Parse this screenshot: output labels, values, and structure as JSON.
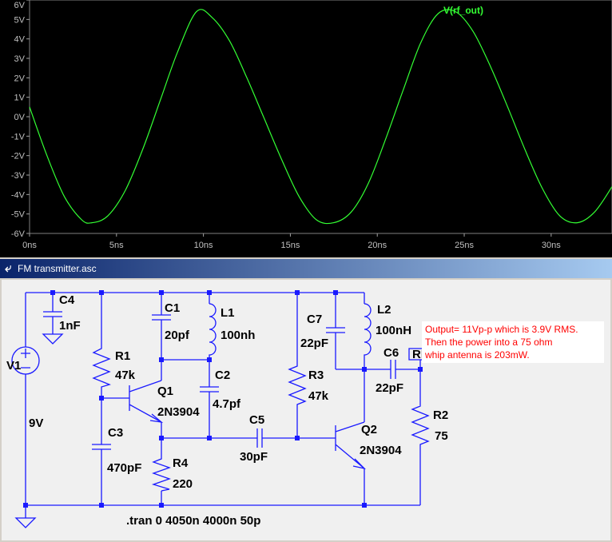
{
  "plot": {
    "trace_label": "V(rf_out)"
  },
  "chart_data": {
    "type": "line",
    "title": "",
    "xlabel": "",
    "ylabel": "",
    "xlim": [
      0,
      33.5
    ],
    "ylim": [
      -6,
      6
    ],
    "x_ticks": [
      "0ns",
      "5ns",
      "10ns",
      "15ns",
      "20ns",
      "25ns",
      "30ns"
    ],
    "y_ticks": [
      "6V",
      "5V",
      "4V",
      "3V",
      "2V",
      "1V",
      "0V",
      "-1V",
      "-2V",
      "-3V",
      "-4V",
      "-5V",
      "-6V"
    ],
    "series": [
      {
        "name": "V(rf_out)",
        "color": "#33ff33",
        "x": [
          0,
          1,
          2,
          3,
          3.6,
          4.5,
          5.5,
          6.5,
          7.5,
          8.5,
          9.6,
          10.5,
          11.5,
          12.5,
          13.5,
          14.5,
          15.5,
          16.5,
          17.5,
          18.5,
          19.5,
          20.5,
          21.5,
          22.5,
          23.5,
          24.5,
          25.5,
          26.5,
          27.5,
          28.5,
          29.5,
          30.5,
          31.5,
          32.5,
          33.5
        ],
        "y": [
          0.5,
          -2.0,
          -4.1,
          -5.3,
          -5.45,
          -5.1,
          -3.8,
          -1.7,
          0.8,
          3.3,
          5.4,
          5.1,
          3.9,
          2.0,
          -0.1,
          -2.2,
          -4.1,
          -5.3,
          -5.45,
          -4.9,
          -3.4,
          -1.1,
          1.4,
          3.8,
          5.3,
          5.4,
          4.4,
          2.6,
          0.5,
          -1.7,
          -3.7,
          -5.1,
          -5.45,
          -4.9,
          -3.6
        ]
      }
    ]
  },
  "schematic": {
    "window_title": "FM transmitter.asc",
    "labels": {
      "c4": "C4",
      "c4_val": "1nF",
      "v1": "V1",
      "v1_val": "9V",
      "r1": "R1",
      "r1_val": "47k",
      "c1": "C1",
      "c1_val": "20pf",
      "l1": "L1",
      "l1_val": "100nh",
      "c2": "C2",
      "c2_val": "4.7pf",
      "q1": "Q1",
      "q1_val": "2N3904",
      "c3": "C3",
      "c3_val": "470pF",
      "r4": "R4",
      "r4_val": "220",
      "c5": "C5",
      "c5_val": "30pF",
      "r3": "R3",
      "r3_val": "47k",
      "c7": "C7",
      "c7_val": "22pF",
      "l2": "L2",
      "l2_val": "100nH",
      "c6": "C6",
      "c6_val": "22pF",
      "q2": "Q2",
      "q2_val": "2N3904",
      "r2": "R2",
      "r2_val": "75",
      "rf_out": "RF_OUT",
      "directive": ".tran 0 4050n 4000n 50p"
    },
    "note_lines": [
      "Output= 11Vp-p which is 3.9V RMS.",
      "Then the power into a 75 ohm",
      "whip antenna is 203mW."
    ]
  }
}
